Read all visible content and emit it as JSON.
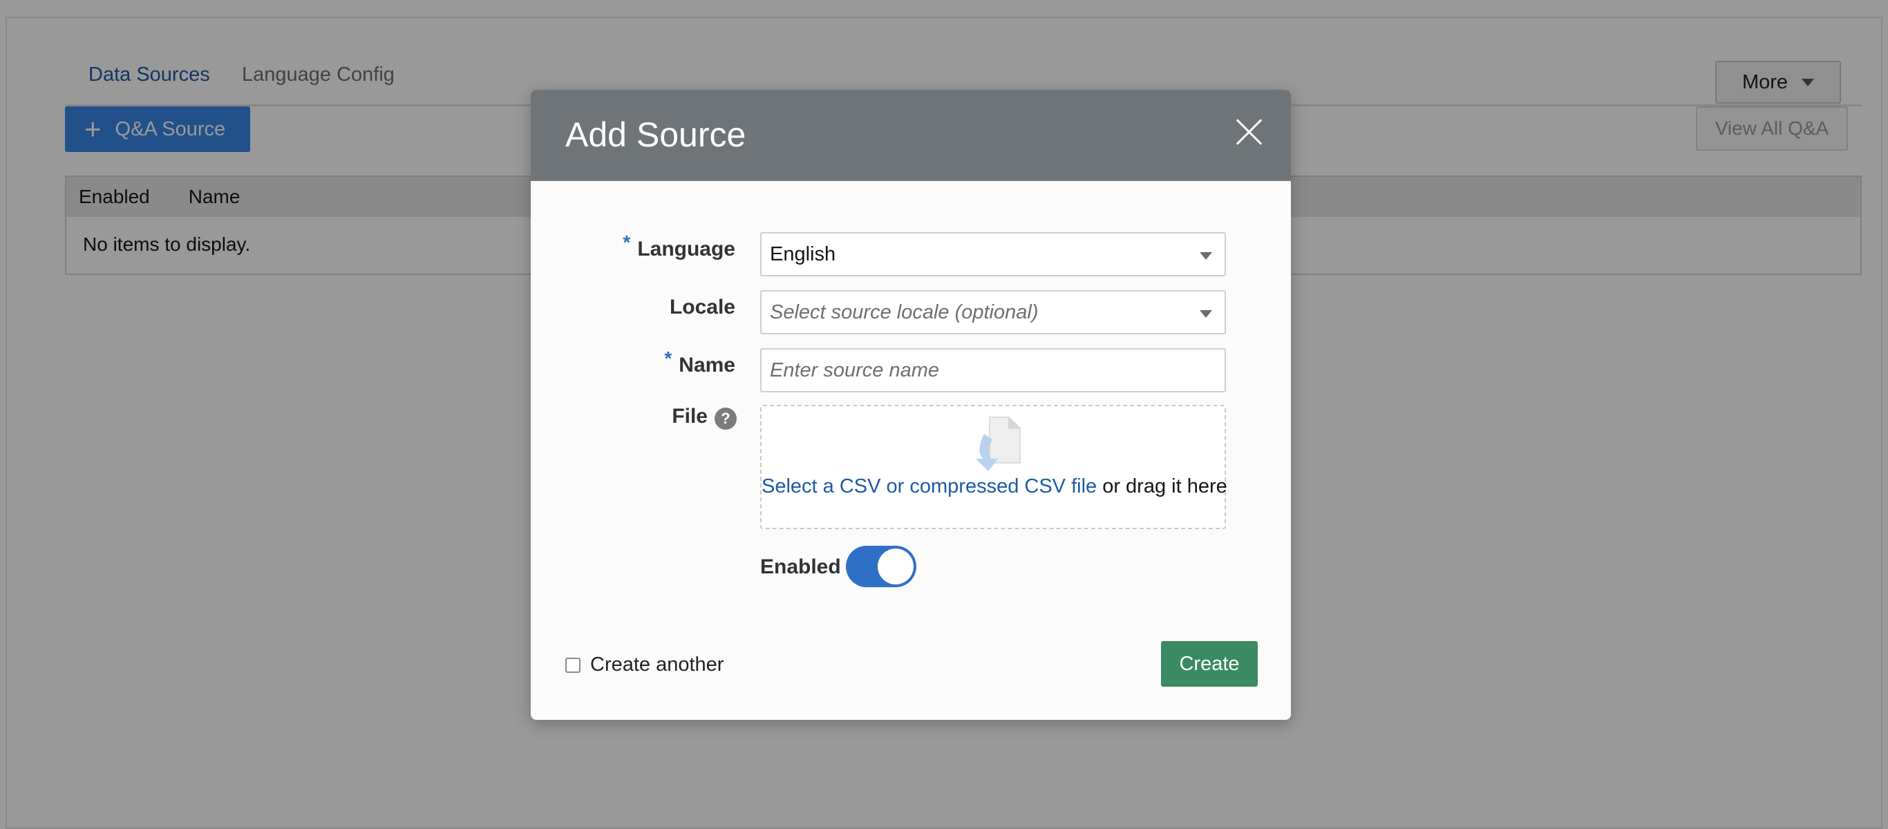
{
  "tabs": {
    "items": [
      {
        "label": "Data Sources",
        "active": true
      },
      {
        "label": "Language Config",
        "active": false
      }
    ]
  },
  "toolbar": {
    "more_label": "More",
    "qa_source_label": "Q&A Source",
    "view_all_label": "View All Q&A"
  },
  "table": {
    "columns": [
      "Enabled",
      "Name"
    ],
    "empty_text": "No items to display."
  },
  "dialog": {
    "title": "Add Source",
    "language": {
      "label": "Language",
      "required_mark": "*",
      "value": "English"
    },
    "locale": {
      "label": "Locale",
      "placeholder": "Select source locale (optional)"
    },
    "name": {
      "label": "Name",
      "required_mark": "*",
      "placeholder": "Enter source name"
    },
    "file": {
      "label": "File",
      "help_glyph": "?",
      "link_text": "Select a CSV or compressed CSV file",
      "rest_text": " or drag it here"
    },
    "enabled": {
      "label": "Enabled",
      "value": true
    },
    "create_another_label": "Create another",
    "create_label": "Create"
  },
  "colors": {
    "overlay": "rgba(0,0,0,0.40)",
    "dialog_header": "#6e7478",
    "primary_blue": "#2f6fc6",
    "create_green": "#3a8a63",
    "link_blue": "#1e5aa6"
  }
}
